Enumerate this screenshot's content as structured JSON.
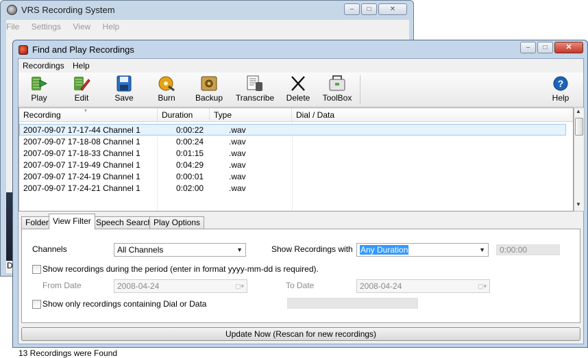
{
  "back_window": {
    "title": "VRS Recording System",
    "menu": [
      "File",
      "Settings",
      "View",
      "Help"
    ],
    "status_fragment": "D"
  },
  "window": {
    "title": "Find and Play Recordings",
    "minimize_icon": "minimize-icon",
    "maximize_icon": "maximize-icon",
    "close_label": "✕"
  },
  "menu": {
    "recordings": "Recordings",
    "help": "Help"
  },
  "toolbar": [
    {
      "label": "Play",
      "icon": "play-icon"
    },
    {
      "label": "Edit",
      "icon": "edit-icon"
    },
    {
      "label": "Save",
      "icon": "save-icon"
    },
    {
      "label": "Burn",
      "icon": "burn-icon"
    },
    {
      "label": "Backup",
      "icon": "backup-icon"
    },
    {
      "label": "Transcribe",
      "icon": "transcribe-icon"
    },
    {
      "label": "Delete",
      "icon": "delete-icon"
    },
    {
      "label": "ToolBox",
      "icon": "toolbox-icon"
    },
    {
      "label": "Help",
      "icon": "help-icon"
    }
  ],
  "table": {
    "columns": [
      "Recording",
      "Duration",
      "Type",
      "Dial / Data"
    ],
    "rows": [
      {
        "recording": "2007-09-07 17-17-44 Channel 1",
        "duration": "0:00:22",
        "type": ".wav",
        "dial": ""
      },
      {
        "recording": "2007-09-07 17-18-08 Channel 1",
        "duration": "0:00:24",
        "type": ".wav",
        "dial": ""
      },
      {
        "recording": "2007-09-07 17-18-33 Channel 1",
        "duration": "0:01:15",
        "type": ".wav",
        "dial": ""
      },
      {
        "recording": "2007-09-07 17-19-49 Channel 1",
        "duration": "0:04:29",
        "type": ".wav",
        "dial": ""
      },
      {
        "recording": "2007-09-07 17-24-19 Channel 1",
        "duration": "0:00:01",
        "type": ".wav",
        "dial": ""
      },
      {
        "recording": "2007-09-07 17-24-21 Channel 1",
        "duration": "0:02:00",
        "type": ".wav",
        "dial": ""
      }
    ]
  },
  "tabs": [
    "Folder",
    "View Filter",
    "Speech Search",
    "Play Options"
  ],
  "filter": {
    "channels_label": "Channels",
    "channels_value": "All Channels",
    "show_with_label": "Show Recordings with",
    "duration_value": "Any Duration",
    "duration_time": "0:00:00",
    "period_label": "Show recordings during the period (enter in format yyyy-mm-dd is required).",
    "from_label": "From Date",
    "from_value": "2008-04-24",
    "to_label": "To Date",
    "to_value": "2008-04-24",
    "dial_label": "Show only recordings containing Dial or Data"
  },
  "update_button": "Update Now (Rescan for new recordings)",
  "status": "13 Recordings were Found",
  "colors": {
    "selection": "#e6f2fc",
    "highlight": "#3399ff",
    "close_button": "#c2382a"
  }
}
